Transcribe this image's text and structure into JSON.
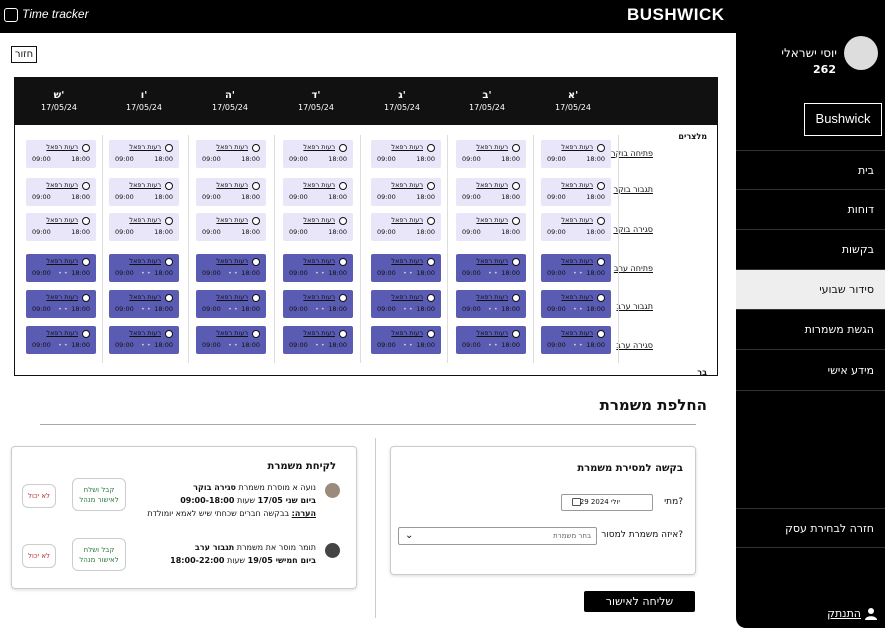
{
  "app": {
    "title": "Time tracker",
    "brand": "BUSHWICK"
  },
  "sidebar": {
    "user_name": "יוסי ישראלי",
    "user_id": "262",
    "business_button": "Bushwick",
    "items": [
      {
        "label": "בית",
        "active": false
      },
      {
        "label": "דוחות",
        "active": false
      },
      {
        "label": "בקשות",
        "active": false
      },
      {
        "label": "סידור שבועי",
        "active": true
      },
      {
        "label": "הגשת משמרות",
        "active": false
      },
      {
        "label": "מידע אישי",
        "active": false
      },
      {
        "label": "חזרה לבחירת עסק",
        "active": false
      }
    ],
    "logout": "התנתק"
  },
  "back_button": "חזור",
  "schedule": {
    "days": [
      {
        "name": "א'",
        "date": "17/05/24"
      },
      {
        "name": "ב'",
        "date": "17/05/24"
      },
      {
        "name": "ג'",
        "date": "17/05/24"
      },
      {
        "name": "ד'",
        "date": "17/05/24"
      },
      {
        "name": "ה'",
        "date": "17/05/24"
      },
      {
        "name": "ו'",
        "date": "17/05/24"
      },
      {
        "name": "ש'",
        "date": "17/05/24"
      }
    ],
    "section_waiters": "מלצרים",
    "section_bar": "בר",
    "rows": [
      "פתיחה בוקר",
      "תגבור בוקר",
      "סגירה בוקר",
      "פתיחה ערב",
      "תגבור ערב",
      "סגירה ערב"
    ],
    "shift": {
      "name": "רעות רפאל",
      "start": "09:00",
      "end": "18:00",
      "dots": "• •"
    }
  },
  "swap": {
    "title": "החלפת משמרת"
  },
  "take": {
    "title": "לקיחת משמרת",
    "requests": [
      {
        "line1a": "נועה א מוסרת משמרת ",
        "line1b": "סגירה בוקר",
        "line2a": "ביום שני 17/05",
        "line2b": " שעות ",
        "line2c": "09:00-18:00",
        "note_label": "הערה:",
        "note_text": " בבקשה חברים שכחתי שיש לאמא יומולדת",
        "accept": "קבל ושלח לאישור מנהל",
        "decline": "לא יכול"
      },
      {
        "line1a": "תומר מוסר את משמרת ",
        "line1b": "תגבור ערב",
        "line2a": "ביום חמישי 19/05",
        "line2b": " שעות ",
        "line2c": "18:00-22:00",
        "accept": "קבל ושלח לאישור מנהל",
        "decline": "לא יכול"
      }
    ]
  },
  "request_form": {
    "title": "בקשה למסירת משמרת",
    "when_label": "מתי?",
    "date_value": "29 יולי 2024",
    "which_label": "איזה משמרת למסור?",
    "select_placeholder": "בחר משמרת",
    "submit": "שליחה לאישור"
  },
  "colors": {
    "accent": "#5a5bb2",
    "light": "#e8e6f8",
    "dark": "#000000"
  }
}
